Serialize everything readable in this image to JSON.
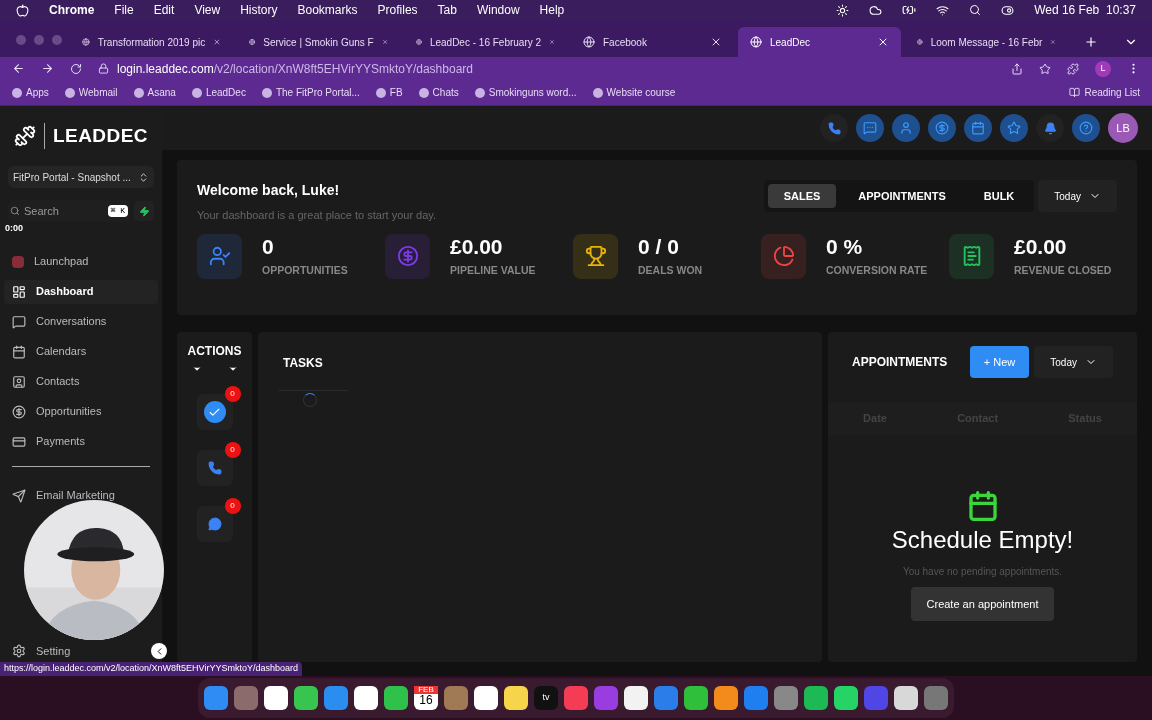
{
  "menu_bar": {
    "app": "Chrome",
    "items": [
      "File",
      "Edit",
      "View",
      "History",
      "Bookmarks",
      "Profiles",
      "Tab",
      "Window",
      "Help"
    ],
    "clock": "Wed 16 Feb  10:37"
  },
  "tabs": [
    {
      "title": "Transformation 2019 pic",
      "selected": false
    },
    {
      "title": "Service | Smokin Guns F",
      "selected": false
    },
    {
      "title": "LeadDec - 16 February 2",
      "selected": false
    },
    {
      "title": "Facebook",
      "selected": false
    },
    {
      "title": "LeadDec",
      "selected": true
    },
    {
      "title": "Loom Message - 16 Febr",
      "selected": false
    }
  ],
  "address": {
    "host": "login.leaddec.com",
    "path": "/v2/location/XnW8ft5EHVirYYSmktoY/dashboard"
  },
  "bookmarks": [
    "Apps",
    "Webmail",
    "Asana",
    "LeadDec",
    "The FitPro Portal...",
    "FB",
    "Chats",
    "Smokinguns word...",
    "Website course"
  ],
  "reading_list": "Reading List",
  "profile_initial": "L",
  "sidebar": {
    "brand": "LEADDEC",
    "account": "FitPro Portal - Snapshot ...",
    "search_placeholder": "Search",
    "shortcut": "⌘ K",
    "timer": "0:00",
    "items": [
      {
        "label": "Launchpad",
        "selected": false
      },
      {
        "label": "Dashboard",
        "selected": true
      },
      {
        "label": "Conversations",
        "selected": false
      },
      {
        "label": "Calendars",
        "selected": false
      },
      {
        "label": "Contacts",
        "selected": false
      },
      {
        "label": "Opportunities",
        "selected": false
      },
      {
        "label": "Payments",
        "selected": false
      }
    ],
    "lower_items": [
      {
        "label": "Email Marketing"
      }
    ],
    "settings": "Setting"
  },
  "header": {
    "avatar": "LB"
  },
  "welcome": {
    "title": "Welcome back, Luke!",
    "subtitle": "Your dashboard is a great place to start your day.",
    "tabs": [
      {
        "label": "SALES",
        "selected": true
      },
      {
        "label": "APPOINTMENTS",
        "selected": false
      },
      {
        "label": "BULK",
        "selected": false
      }
    ],
    "range": "Today"
  },
  "stats": [
    {
      "value": "0",
      "label": "OPPORTUNITIES",
      "color": "#3b82f6"
    },
    {
      "value": "£0.00",
      "label": "PIPELINE VALUE",
      "color": "#7c3aed"
    },
    {
      "value": "0 / 0",
      "label": "DEALS WON",
      "color": "#eab308"
    },
    {
      "value": "0 %",
      "label": "CONVERSION RATE",
      "color": "#ef4444"
    },
    {
      "value": "£0.00",
      "label": "REVENUE CLOSED",
      "color": "#22c55e"
    }
  ],
  "actions": {
    "title": "ACTIONS",
    "badges": [
      "0",
      "0",
      "0"
    ]
  },
  "tasks": {
    "title": "TASKS"
  },
  "appointments": {
    "title": "APPOINTMENTS",
    "new_button": "+ New",
    "range": "Today",
    "columns": [
      "Date",
      "Contact",
      "Status"
    ],
    "empty_title": "Schedule Empty!",
    "empty_text": "You have no pending appointments.",
    "create_button": "Create an appointment"
  },
  "status_url": "https://login.leaddec.com/v2/location/XnW8ft5EHVirYYSmktoY/dashboard",
  "dock": {
    "calendar_month": "FEB",
    "calendar_day": "16",
    "tv_label": "tv"
  }
}
